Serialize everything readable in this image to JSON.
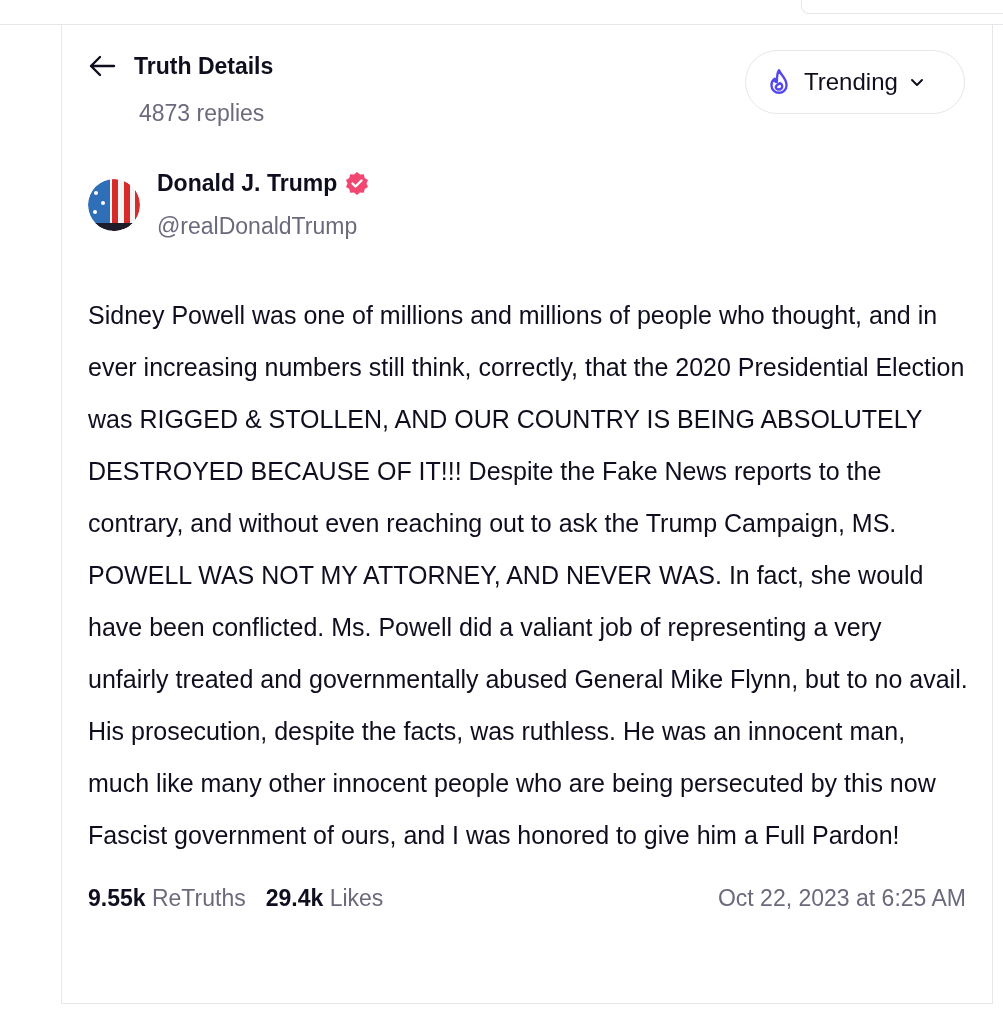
{
  "header": {
    "title": "Truth Details",
    "replies": "4873 replies"
  },
  "sort_menu": {
    "label": "Trending"
  },
  "author": {
    "name": "Donald J. Trump",
    "verified": true,
    "handle": "@realDonaldTrump"
  },
  "post": {
    "text": "Sidney Powell was one of millions and millions of people who thought, and in ever increasing numbers still think, correctly, that the 2020 Presidential Election was RIGGED & STOLLEN, AND OUR COUNTRY IS BEING ABSOLUTELY DESTROYED BECAUSE OF IT!!! Despite the Fake News reports to the contrary, and without even reaching out to ask the Trump Campaign, MS. POWELL WAS NOT MY ATTORNEY, AND NEVER WAS. In fact, she would have been conflicted. Ms. Powell did a valiant job of representing a very unfairly treated and governmentally abused General Mike Flynn, but to no avail. His prosecution, despite the facts, was ruthless. He was an innocent man, much like many other innocent people who are being persecuted by this now Fascist government of ours, and I was honored to give him a Full Pardon!"
  },
  "stats": [
    {
      "count": "9.55k",
      "label": "ReTruths"
    },
    {
      "count": "29.4k",
      "label": "Likes"
    }
  ],
  "timestamp": "Oct 22, 2023 at 6:25 AM"
}
